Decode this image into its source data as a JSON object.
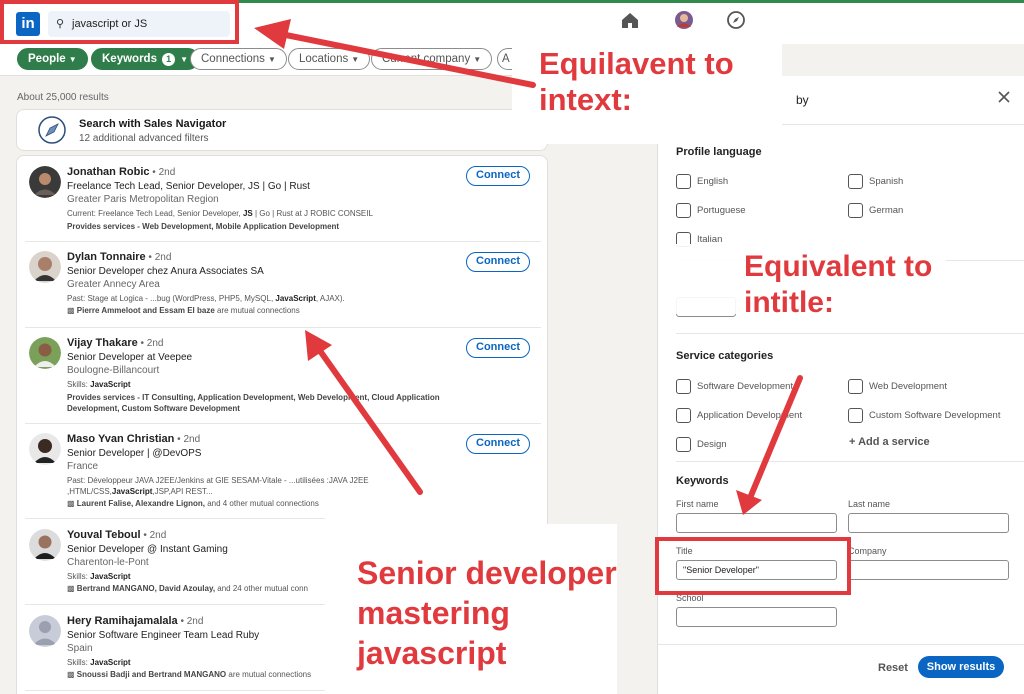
{
  "topbar": {
    "logo": "in",
    "search_value": "javascript or JS"
  },
  "filters": {
    "people": "People",
    "keywords": "Keywords",
    "keywords_count": "1",
    "connections": "Connections",
    "locations": "Locations",
    "current_company": "Current company",
    "more": "A"
  },
  "results_count": "About 25,000 results",
  "sales_nav": {
    "title": "Search with Sales Navigator",
    "subtitle": "12 additional advanced filters"
  },
  "results": [
    {
      "name": "Jonathan Robic",
      "degree": " • 2nd",
      "headline": "Freelance Tech Lead, Senior Developer, JS | Go | Rust",
      "location": "Greater Paris Metropolitan Region",
      "snippet_pre": "Current: Freelance Tech Lead, Senior Developer, ",
      "snippet_bold": "JS",
      "snippet_post": " | Go | Rust at J ROBIC CONSEIL",
      "services": "Provides services - Web Development, Mobile Application Development",
      "connect": "Connect"
    },
    {
      "name": "Dylan Tonnaire",
      "degree": " • 2nd",
      "headline": "Senior Developer chez Anura Associates SA",
      "location": "Greater Annecy Area",
      "snippet_pre": "Past: Stage at Logica - ...bug (WordPress, PHP5, MySQL, ",
      "snippet_bold": "JavaScript",
      "snippet_post": ", AJAX).",
      "mutual_bold": "Pierre Ammeloot and Essam El baze",
      "mutual_rest": " are mutual connections",
      "connect": "Connect"
    },
    {
      "name": "Vijay Thakare",
      "degree": " • 2nd",
      "headline": "Senior Developer at Veepee",
      "location": "Boulogne-Billancourt",
      "snippet_pre": "Skills: ",
      "snippet_bold": "JavaScript",
      "snippet_post": "",
      "services": "Provides services - IT Consulting, Application Development, Web Development, Cloud Application Development, Custom Software Development",
      "connect": "Connect"
    },
    {
      "name": "Maso Yvan Christian",
      "degree": " • 2nd",
      "headline": "Senior Developer | @DevOPS",
      "location": "France",
      "snippet_pre": "Past: Développeur JAVA J2EE/Jenkins at GIE SESAM-Vitale - ...utilisées :JAVA J2EE ,HTML/CSS,",
      "snippet_bold": "JavaScript",
      "snippet_post": ",JSP,API REST...",
      "mutual_bold": "Laurent Falise, Alexandre Lignon,",
      "mutual_rest": " and 4 other mutual connections",
      "connect": "Connect"
    },
    {
      "name": "Youval Teboul",
      "degree": " • 2nd",
      "headline": "Senior Developer @ Instant Gaming",
      "location": "Charenton-le-Pont",
      "snippet_pre": "Skills: ",
      "snippet_bold": "JavaScript",
      "snippet_post": "",
      "mutual_bold": "Bertrand MANGANO, David Azoulay,",
      "mutual_rest": " and 24 other mutual conn"
    },
    {
      "name": "Hery Ramihajamalala",
      "degree": " • 2nd",
      "headline": "Senior Software Engineer Team Lead Ruby",
      "location": "Spain",
      "snippet_pre": "Skills: ",
      "snippet_bold": "JavaScript",
      "snippet_post": "",
      "mutual_bold": "Snoussi Badji and Bertrand MANGANO",
      "mutual_rest": " are mutual connections"
    }
  ],
  "panel": {
    "title_tail": "by",
    "profile_language": "Profile language",
    "languages": [
      "English",
      "Spanish",
      "Portuguese",
      "German",
      "Italian"
    ],
    "service_categories": "Service categories",
    "services": [
      "Software Development",
      "Web Development",
      "Application Development",
      "Custom Software Development",
      "Design"
    ],
    "add_service": "+ Add a service",
    "keywords": "Keywords",
    "first_name": "First name",
    "last_name": "Last name",
    "title_label": "Title",
    "title_value": "\"Senior Developer\"",
    "company": "Company",
    "school": "School",
    "reset": "Reset",
    "show_results": "Show results"
  },
  "annotations": {
    "intext": "Equilavent to\nintext:",
    "intitle": "Equivalent to\nintitle:",
    "senior": "Senior developer\nmastering\njavascript"
  },
  "colors": {
    "annotation_red": "#e03a3e",
    "linkedin_blue": "#0a66c2",
    "filter_green": "#2f7d4a"
  }
}
